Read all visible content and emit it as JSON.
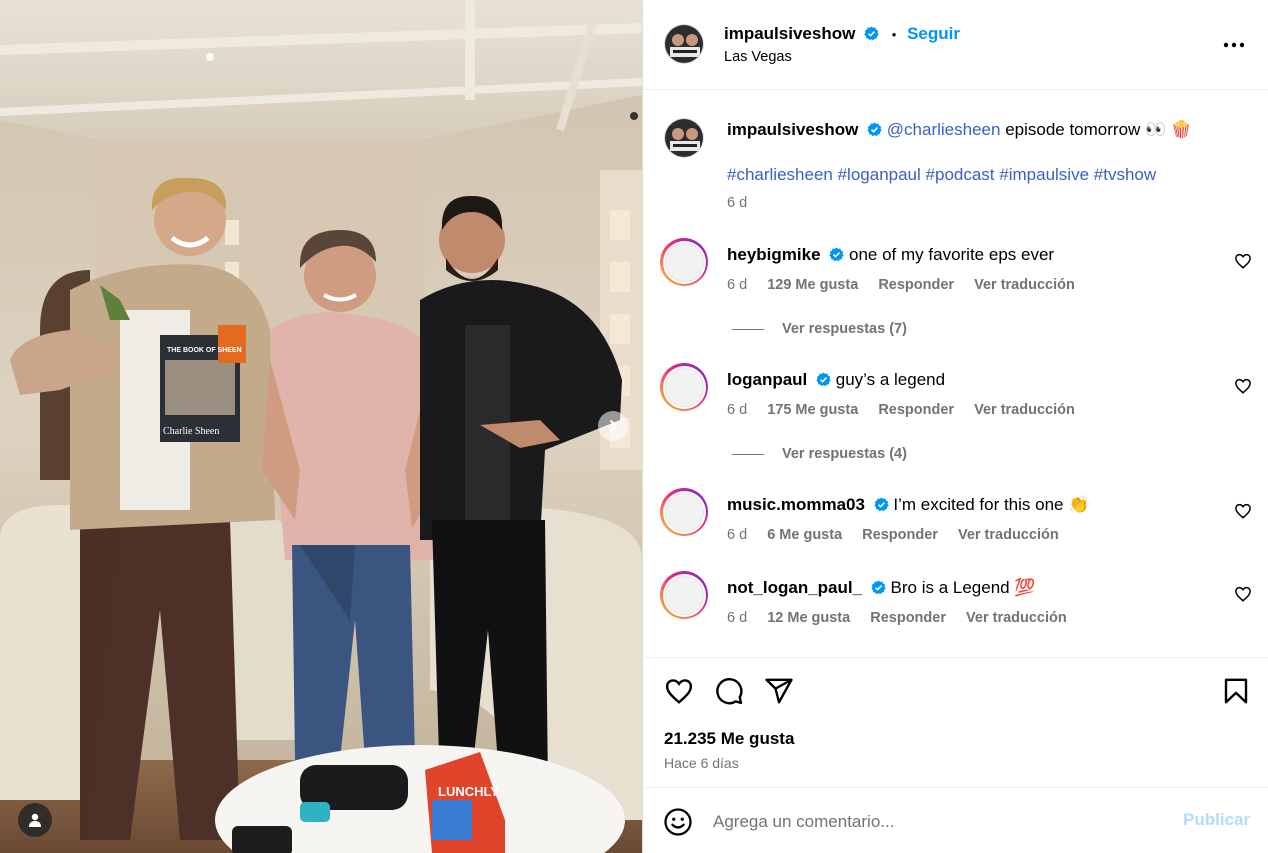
{
  "post": {
    "username": "impaulsiveshow",
    "follow_label": "Seguir",
    "dot": "•",
    "location": "Las Vegas",
    "more_icon": "more-horizontal-icon"
  },
  "caption": {
    "username": "impaulsiveshow",
    "mention": "@charliesheen",
    "text": "episode tomorrow 👀 🍿",
    "hashtags": [
      "#charliesheen",
      "#loganpaul",
      "#podcast",
      "#impaulsive",
      "#tvshow"
    ],
    "age": "6 d"
  },
  "comments": [
    {
      "username": "heybigmike",
      "text": "one of my favorite eps ever",
      "age": "6 d",
      "likes": "129 Me gusta",
      "reply": "Responder",
      "translate": "Ver traducción",
      "replies": "Ver respuestas (7)"
    },
    {
      "username": "loganpaul",
      "text": "guy’s a legend",
      "age": "6 d",
      "likes": "175 Me gusta",
      "reply": "Responder",
      "translate": "Ver traducción",
      "replies": "Ver respuestas (4)"
    },
    {
      "username": "music.momma03",
      "text": "I’m excited for this one 👏",
      "age": "6 d",
      "likes": "6 Me gusta",
      "reply": "Responder",
      "translate": "Ver traducción"
    },
    {
      "username": "not_logan_paul_",
      "text": "Bro is a Legend 💯",
      "age": "6 d",
      "likes": "12 Me gusta",
      "reply": "Responder",
      "translate": "Ver traducción"
    }
  ],
  "photo": {
    "book_title": "THE BOOK OF SHEEN",
    "book_author": "Charlie Sheen",
    "box_text": "LUNCHLY"
  },
  "actions": {
    "like_count": "21.235 Me gusta",
    "posted_ago": "Hace 6 días",
    "icons": [
      "heart-icon",
      "comment-icon",
      "share-icon",
      "bookmark-icon"
    ]
  },
  "composer": {
    "placeholder": "Agrega un comentario...",
    "post_label": "Publicar",
    "emoji_icon": "smiley-icon"
  },
  "colors": {
    "link": "#0095f6",
    "hashtag": "#3b5fc4",
    "secondary": "#737373",
    "verified": "#0095f6"
  }
}
